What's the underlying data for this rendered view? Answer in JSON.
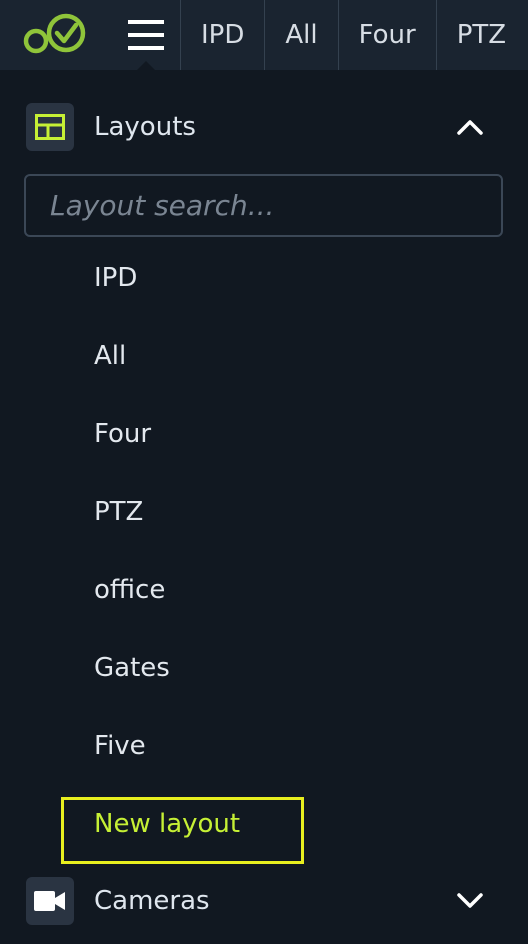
{
  "topbar": {
    "tabs": [
      {
        "label": "IPD"
      },
      {
        "label": "All"
      },
      {
        "label": "Four"
      },
      {
        "label": "PTZ"
      }
    ]
  },
  "layouts_section": {
    "label": "Layouts",
    "icon": "layout-grid-icon",
    "expanded": true
  },
  "search": {
    "placeholder": "Layout search...",
    "value": ""
  },
  "layouts": [
    {
      "label": "IPD"
    },
    {
      "label": "All"
    },
    {
      "label": "Four"
    },
    {
      "label": "PTZ"
    },
    {
      "label": "office"
    },
    {
      "label": "Gates"
    },
    {
      "label": "Five"
    },
    {
      "label": "New layout",
      "selected": true
    }
  ],
  "cameras_section": {
    "label": "Cameras",
    "icon": "video-camera-icon",
    "expanded": false
  },
  "colors": {
    "background": "#111821",
    "topbar": "#1a2430",
    "accent_green": "#8fc43a",
    "selected_text": "#c6f035",
    "highlight_border": "#e8ee1f"
  }
}
